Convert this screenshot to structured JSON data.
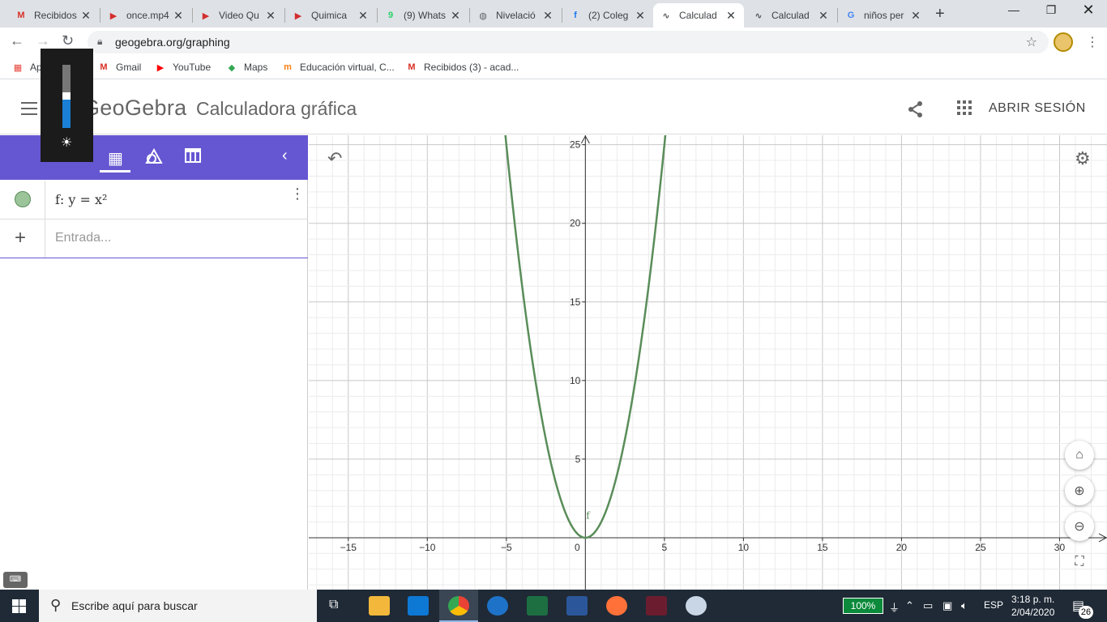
{
  "browser": {
    "tabs": [
      {
        "title": "Recibidos",
        "favicon": "gmail-icon",
        "color": "#d93025",
        "glyph": "M",
        "active": false
      },
      {
        "title": "once.mp4",
        "favicon": "video-clap-icon",
        "color": "#d32f2f",
        "glyph": "▶",
        "active": false
      },
      {
        "title": "Video Qu",
        "favicon": "video-clap-icon",
        "color": "#d32f2f",
        "glyph": "▶",
        "active": false
      },
      {
        "title": "Quimica",
        "favicon": "video-clap-icon",
        "color": "#d32f2f",
        "glyph": "▶",
        "active": false
      },
      {
        "title": "(9) Whats",
        "favicon": "whatsapp-icon",
        "color": "#25d366",
        "glyph": "9",
        "active": false
      },
      {
        "title": "Nivelació",
        "favicon": "globe-icon",
        "color": "#5f6368",
        "glyph": "◍",
        "active": false
      },
      {
        "title": "(2) Coleg",
        "favicon": "facebook-icon",
        "color": "#1877f2",
        "glyph": "f",
        "active": false
      },
      {
        "title": "Calculad",
        "favicon": "geogebra-icon",
        "color": "#555555",
        "glyph": "∿",
        "active": true
      },
      {
        "title": "Calculad",
        "favicon": "geogebra-icon",
        "color": "#555555",
        "glyph": "∿",
        "active": false
      },
      {
        "title": "niños per",
        "favicon": "google-icon",
        "color": "#4285f4",
        "glyph": "G",
        "active": false
      }
    ],
    "url": "geogebra.org/graphing",
    "bookmarks": [
      {
        "label": "Aplicaciones",
        "icon": "apps-grid-icon",
        "color": "#e8453c",
        "glyph": "▦"
      },
      {
        "label": "Gmail",
        "icon": "gmail-icon",
        "color": "#d93025",
        "glyph": "M"
      },
      {
        "label": "YouTube",
        "icon": "youtube-icon",
        "color": "#ff0000",
        "glyph": "▶"
      },
      {
        "label": "Maps",
        "icon": "maps-icon",
        "color": "#34a853",
        "glyph": "◆"
      },
      {
        "label": "Educación virtual, C...",
        "icon": "moodle-icon",
        "color": "#f98012",
        "glyph": "m"
      },
      {
        "label": "Recibidos (3) - acad...",
        "icon": "gmail-icon",
        "color": "#d93025",
        "glyph": "M"
      }
    ]
  },
  "geogebra": {
    "logo": "GeoGebra",
    "title": "Calculadora gráfica",
    "signin": "ABRIR SESIÓN",
    "algebra": {
      "entries": [
        {
          "name": "f",
          "expression": "f: y = x²",
          "color": "#9bc49a"
        }
      ],
      "input_placeholder": "Entrada..."
    }
  },
  "brightness_level": 0.45,
  "chart_data": {
    "type": "line",
    "series": [
      {
        "name": "f",
        "expression": "y = x^2",
        "color": "#5a8d59"
      }
    ],
    "xlim": [
      -17.5,
      33
    ],
    "ylim": [
      -3.3,
      25.6
    ],
    "x_ticks": [
      -15,
      -10,
      -5,
      0,
      5,
      10,
      15,
      20,
      25,
      30
    ],
    "y_ticks": [
      5,
      10,
      15,
      20,
      25
    ],
    "x_tick_labels": [
      "−15",
      "−10",
      "−5",
      "0",
      "5",
      "10",
      "15",
      "20",
      "25",
      "30"
    ],
    "y_tick_labels": [
      "5",
      "10",
      "15",
      "20",
      "25"
    ],
    "grid": true
  },
  "taskbar": {
    "search_placeholder": "Escribe aquí para buscar",
    "battery": "100%",
    "language": "ESP",
    "time": "3:18 p. m.",
    "date": "2/04/2020",
    "notifications": "26"
  }
}
